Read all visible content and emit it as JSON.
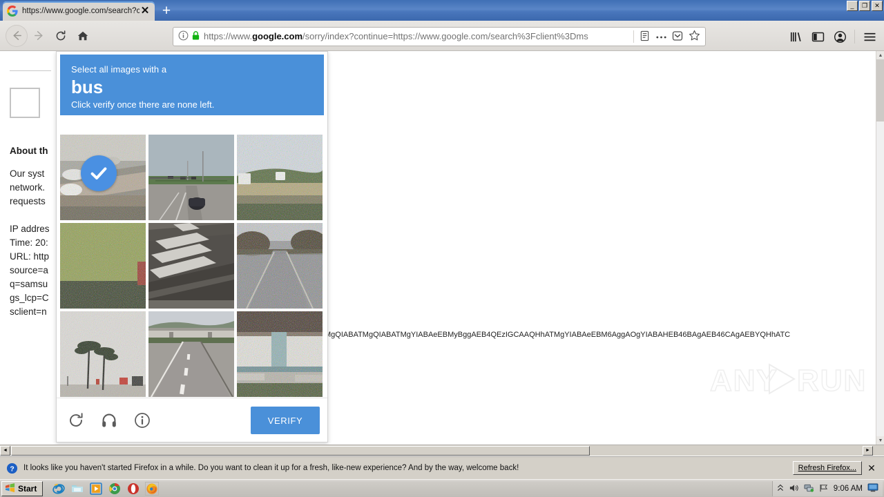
{
  "window": {
    "controls": {
      "minimize": "_",
      "restore": "❐",
      "close": "✕"
    }
  },
  "tab": {
    "favicon": "google-g-icon",
    "title": "https://www.google.com/search?c",
    "close_label": "✕",
    "newtab_label": "+"
  },
  "toolbar": {
    "back": "back-arrow-icon",
    "forward": "forward-arrow-icon",
    "reload": "reload-icon",
    "home": "home-icon",
    "library": "library-icon",
    "sidebar": "sidebar-icon",
    "account": "account-icon",
    "menu": "hamburger-menu-icon"
  },
  "urlbar": {
    "identity_icon": "info-circle-icon",
    "lock_icon": "padlock-icon",
    "scheme": "https://www.",
    "domain": "google.com",
    "path": "/sorry/index?continue=https://www.google.com/search%3Fclient%3Dms",
    "reader_icon": "reader-view-icon",
    "page_actions_icon": "ellipsis-icon",
    "pocket_icon": "pocket-icon",
    "bookmark_icon": "star-icon"
  },
  "page": {
    "heading": "About th",
    "para1": "Our syst\nnetwork.\nrequests",
    "para2": "IP addres\nTime: 20:\nURL: http\nsource=a\nq=samsu\ngs_lcp=C\nsclient=n",
    "long_token": "MgQIABATMgQIABATMgYIABAeEBMyBggAEB4QEzIGCAAQHhATMgYIABAeEBM6AggAOgYIABAHEB46BAgAEB46CAgAEBYQHhATC"
  },
  "captcha": {
    "prompt_prefix": "Select all images with a",
    "target": "bus",
    "instruction": "Click verify once there are none left.",
    "refresh_icon": "refresh-icon",
    "audio_icon": "headphones-icon",
    "info_icon": "info-circle-icon",
    "verify_label": "VERIFY",
    "selected_check_icon": "checkmark-icon",
    "tiles": [
      {
        "index": 1,
        "alt": "highway traffic with cars and barrier",
        "selected": true
      },
      {
        "index": 2,
        "alt": "road with traffic lights and a car",
        "selected": false
      },
      {
        "index": 3,
        "alt": "highway with trucks beside trees",
        "selected": false
      },
      {
        "index": 4,
        "alt": "green grass field beside road",
        "selected": false
      },
      {
        "index": 5,
        "alt": "crosswalk markings on asphalt",
        "selected": false
      },
      {
        "index": 6,
        "alt": "road lined with trees",
        "selected": false
      },
      {
        "index": 7,
        "alt": "palm trees and street signs",
        "selected": false
      },
      {
        "index": 8,
        "alt": "empty highway under an overpass",
        "selected": false
      },
      {
        "index": 9,
        "alt": "overpass pillar above a town",
        "selected": false
      }
    ]
  },
  "notification": {
    "icon": "help-circle-icon",
    "message": "It looks like you haven't started Firefox in a while. Do you want to clean it up for a fresh, like-new experience? And by the way, welcome back!",
    "action_label": "Refresh Firefox...",
    "close_label": "✕"
  },
  "taskbar": {
    "start_label": "Start",
    "quick_launch": [
      "internet-explorer-icon",
      "folder-icon",
      "media-player-icon",
      "chrome-icon",
      "opera-icon",
      "firefox-icon"
    ],
    "tray": {
      "expand_icon": "chevron-up-icon",
      "volume_icon": "speaker-icon",
      "network_icon": "network-icon",
      "flag_icon": "flag-icon",
      "time": "9:06 AM",
      "desktop_icon": "show-desktop-icon"
    }
  },
  "watermark": {
    "text": "ANY.RUN"
  },
  "colors": {
    "captcha_blue": "#4a90d9",
    "titlebar_blue": "#4a77bd",
    "taskbar_grey": "#c0bdb8"
  }
}
